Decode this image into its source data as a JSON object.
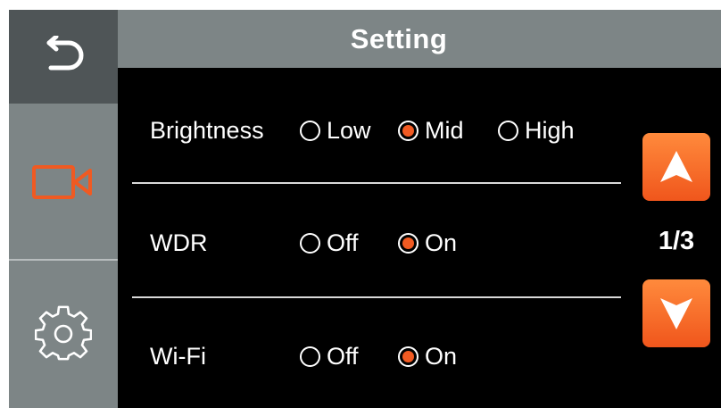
{
  "header": {
    "title": "Setting"
  },
  "sidebar": {
    "items": [
      {
        "icon": "back-arrow-icon",
        "active": true
      },
      {
        "icon": "video-camera-icon",
        "active": false
      },
      {
        "icon": "gear-icon",
        "active": false
      }
    ]
  },
  "settings": [
    {
      "label": "Brightness",
      "options": [
        {
          "label": "Low",
          "selected": false
        },
        {
          "label": "Mid",
          "selected": true
        },
        {
          "label": "High",
          "selected": false
        }
      ]
    },
    {
      "label": "WDR",
      "options": [
        {
          "label": "Off",
          "selected": false
        },
        {
          "label": "On",
          "selected": true
        }
      ]
    },
    {
      "label": "Wi-Fi",
      "options": [
        {
          "label": "Off",
          "selected": false
        },
        {
          "label": "On",
          "selected": true
        }
      ]
    }
  ],
  "pagination": {
    "indicator": "1/3",
    "up_icon": "arrow-up-icon",
    "down_icon": "arrow-down-icon"
  },
  "colors": {
    "accent": "#f05a22",
    "sidebar": "#7d8586",
    "sidebar_active": "#4f5557",
    "background": "#000000"
  }
}
